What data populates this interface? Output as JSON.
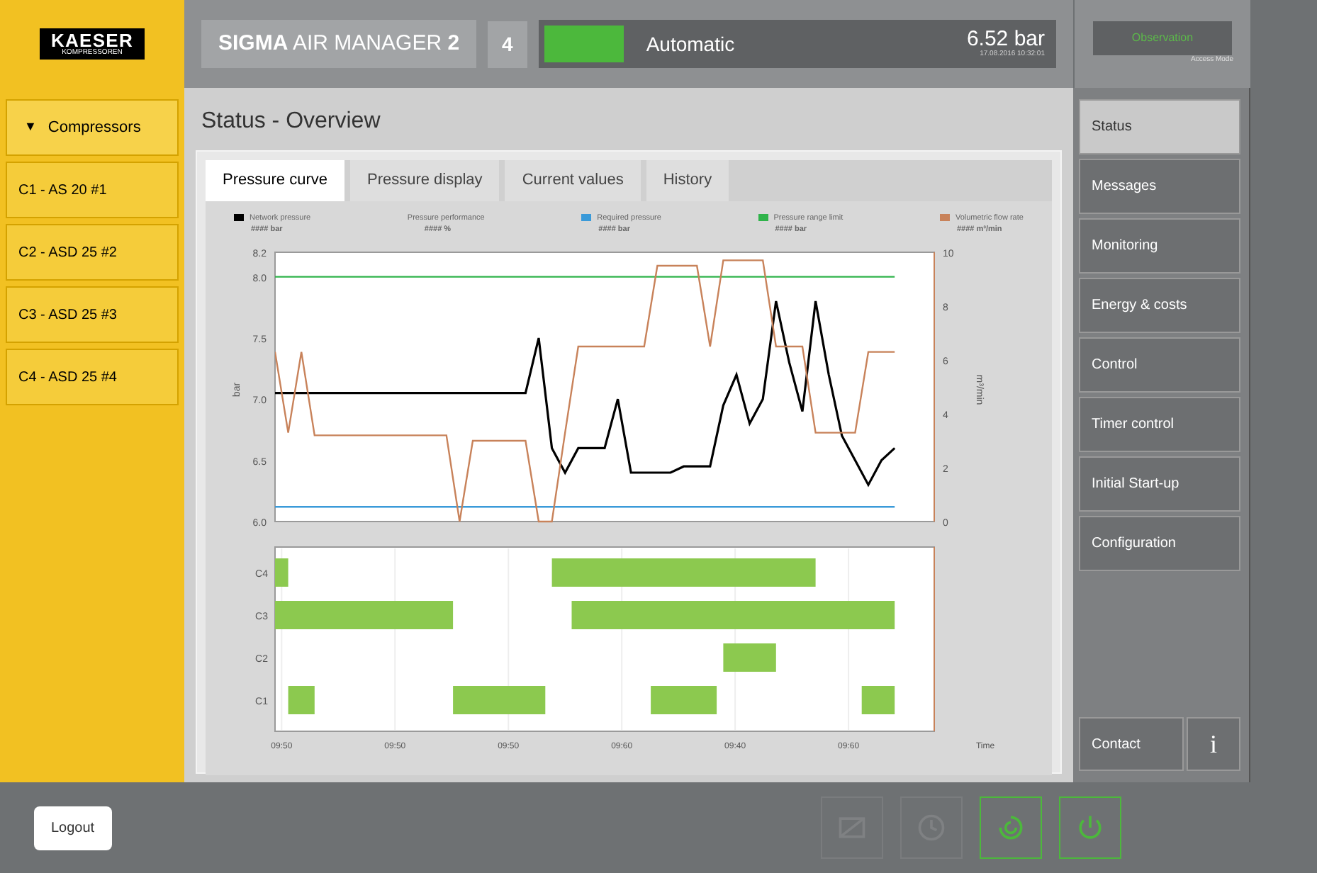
{
  "header": {
    "logo": {
      "name": "KAESER",
      "sub": "KOMPRESSOREN"
    },
    "title": "**SIGMA** AIR MANAGER **2**",
    "count": "4",
    "running": true,
    "mode": "Automatic",
    "pressure": "6.52 bar",
    "timestamp": "17.08.2016 10:32:01",
    "access": {
      "label": "Observation",
      "sub": "Access Mode"
    }
  },
  "sidebar": {
    "header": {
      "icon": "▼",
      "label": "Compressors",
      "expanded": true
    },
    "items": [
      {
        "label": "C1 - AS 20 #1",
        "selected": false
      },
      {
        "label": "C2 - ASD 25 #2",
        "selected": false
      },
      {
        "label": "C3 - ASD 25 #3",
        "selected": false
      },
      {
        "label": "C4 - ASD 25 #4",
        "selected": false
      }
    ]
  },
  "page_title": "Status - Overview",
  "tabs": [
    {
      "label": "Pressure curve",
      "selected": true
    },
    {
      "label": "Pressure display",
      "selected": false
    },
    {
      "label": "Current values",
      "selected": false
    },
    {
      "label": "History",
      "selected": false
    }
  ],
  "legend": [
    {
      "name": "Network pressure",
      "value": "#### bar",
      "color": "#000000"
    },
    {
      "name": "Pressure performance",
      "value": "#### %"
    },
    {
      "name": "Required pressure",
      "value": "#### bar",
      "color": "#3a9ad9"
    },
    {
      "name": "Pressure range limit",
      "value": "#### bar",
      "color": "#2fb34a"
    },
    {
      "name": "Volumetric flow rate",
      "value": "#### m³/min",
      "color": "#c8825a"
    }
  ],
  "pressure_plot": {
    "chart_data": {
      "type": "line",
      "ylabel": "bar",
      "ylim": [
        6.0,
        8.2
      ],
      "yticks": [
        {
          "value": 6.0,
          "label": "6.0"
        },
        {
          "value": 6.5,
          "label": "6.5"
        },
        {
          "value": 7.0,
          "label": "7.0"
        },
        {
          "value": 7.5,
          "label": "7.5"
        },
        {
          "value": 8.0,
          "label": "8.0"
        },
        {
          "value": 8.2,
          "label": "8.2"
        }
      ],
      "categories": [
        null,
        null,
        null,
        null,
        null,
        null,
        null,
        null,
        null,
        null,
        null,
        null,
        null,
        null,
        null,
        null,
        null,
        null,
        null,
        null,
        null,
        null,
        null,
        null,
        null,
        null,
        null,
        null,
        null,
        null,
        null,
        null,
        null,
        null,
        null,
        null,
        null,
        null,
        null,
        null,
        null,
        null,
        null,
        null,
        null,
        null,
        null,
        null
      ],
      "series": [
        {
          "color": "#000000",
          "values": [
            7.05,
            7.05,
            7.05,
            7.05,
            7.05,
            7.05,
            7.05,
            7.05,
            7.05,
            7.05,
            7.05,
            7.05,
            7.05,
            7.05,
            7.05,
            7.05,
            7.05,
            7.05,
            7.05,
            7.05,
            7.5,
            6.6,
            6.4,
            6.6,
            6.6,
            6.6,
            7.0,
            6.4,
            6.4,
            6.4,
            6.4,
            6.45,
            6.45,
            6.45,
            6.95,
            7.2,
            6.8,
            7.0,
            7.8,
            7.3,
            6.9,
            7.8,
            7.2,
            6.7,
            6.5,
            6.3,
            6.5,
            6.6
          ]
        },
        {
          "color": "#3a9ad9",
          "values": [
            6.12,
            6.12,
            6.12,
            6.12,
            6.12,
            6.12,
            6.12,
            6.12,
            6.12,
            6.12,
            6.12,
            6.12,
            6.12,
            6.12,
            6.12,
            6.12,
            6.12,
            6.12,
            6.12,
            6.12,
            6.12,
            6.12,
            6.12,
            6.12,
            6.12,
            6.12,
            6.12,
            6.12,
            6.12,
            6.12,
            6.12,
            6.12,
            6.12,
            6.12,
            6.12,
            6.12,
            6.12,
            6.12,
            6.12,
            6.12,
            6.12,
            6.12,
            6.12,
            6.12,
            6.12,
            6.12,
            6.12,
            6.12
          ]
        },
        {
          "color": "#2fb34a",
          "values": [
            8.0,
            8.0,
            8.0,
            8.0,
            8.0,
            8.0,
            8.0,
            8.0,
            8.0,
            8.0,
            8.0,
            8.0,
            8.0,
            8.0,
            8.0,
            8.0,
            8.0,
            8.0,
            8.0,
            8.0,
            8.0,
            8.0,
            8.0,
            8.0,
            8.0,
            8.0,
            8.0,
            8.0,
            8.0,
            8.0,
            8.0,
            8.0,
            8.0,
            8.0,
            8.0,
            8.0,
            8.0,
            8.0,
            8.0,
            8.0,
            8.0,
            8.0,
            8.0,
            8.0,
            8.0,
            8.0,
            8.0,
            8.0
          ]
        }
      ]
    }
  },
  "flow_plot": {
    "chart_data": {
      "type": "line",
      "ylabel": "m³/min",
      "ylim": [
        0,
        10
      ],
      "yticks": [
        0,
        2,
        4,
        6,
        8,
        10
      ],
      "categories": [
        null,
        null,
        null,
        null,
        null,
        null,
        null,
        null,
        null,
        null,
        null,
        null,
        null,
        null,
        null,
        null,
        null,
        null,
        null,
        null,
        null,
        null,
        null,
        null,
        null,
        null,
        null,
        null,
        null,
        null,
        null,
        null,
        null,
        null,
        null,
        null,
        null,
        null,
        null,
        null,
        null,
        null,
        null,
        null,
        null,
        null,
        null,
        null
      ],
      "series": [
        {
          "color": "#c8825a",
          "values": [
            6.3,
            3.3,
            6.3,
            3.2,
            3.2,
            3.2,
            3.2,
            3.2,
            3.2,
            3.2,
            3.2,
            3.2,
            3.2,
            3.2,
            0,
            3.0,
            3.0,
            3.0,
            3.0,
            3.0,
            0,
            0,
            3.3,
            6.5,
            6.5,
            6.5,
            6.5,
            6.5,
            6.5,
            9.5,
            9.5,
            9.5,
            9.5,
            6.5,
            9.7,
            9.7,
            9.7,
            9.7,
            6.5,
            6.5,
            6.5,
            3.3,
            3.3,
            3.3,
            3.3,
            6.3,
            6.3,
            6.3
          ]
        }
      ]
    }
  },
  "timeline": {
    "rows": [
      "C4",
      "C3",
      "C2",
      "C1"
    ],
    "times": [
      "09:50",
      "09:50",
      "09:50",
      "09:60",
      "09:40",
      "09:60"
    ],
    "time_label": "Time"
  },
  "nav": [
    {
      "label": "Status",
      "selected": true
    },
    {
      "label": "Messages",
      "selected": false
    },
    {
      "label": "Monitoring",
      "selected": false
    },
    {
      "label": "Energy & costs",
      "selected": false
    },
    {
      "label": "Control",
      "selected": false
    },
    {
      "label": "Timer control",
      "selected": false
    },
    {
      "label": "Initial Start-up",
      "selected": false
    },
    {
      "label": "Configuration",
      "selected": false
    }
  ],
  "contact": "Contact",
  "info": "i",
  "logout": "Logout",
  "footer_buttons": [
    {
      "kind": "chart",
      "disabled": true
    },
    {
      "kind": "clock",
      "disabled": true
    },
    {
      "kind": "swirl",
      "disabled": false
    },
    {
      "kind": "power",
      "disabled": false
    }
  ]
}
